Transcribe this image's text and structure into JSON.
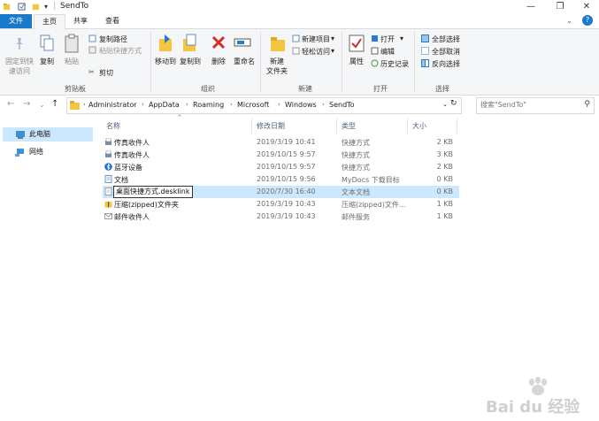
{
  "window": {
    "title": "SendTo",
    "controls": [
      "minimize-icon",
      "maximize-icon",
      "close-icon"
    ]
  },
  "tabs": [
    {
      "label": "文件"
    },
    {
      "label": "主页"
    },
    {
      "label": "共享"
    },
    {
      "label": "查看"
    }
  ],
  "ribbon": {
    "clipboard": {
      "pin_label_1": "固定到快",
      "pin_label_2": "速访问",
      "copy_label": "复制",
      "paste_label": "粘贴",
      "copy_path_label": "复制路径",
      "paste_shortcut_label": "粘贴快捷方式",
      "cut_label": "剪切",
      "group_label": "剪贴板"
    },
    "organize": {
      "move_to_label": "移动到",
      "copy_to_label": "复制到",
      "delete_label": "删除",
      "rename_label": "重命名",
      "group_label": "组织"
    },
    "new": {
      "new_folder_label_1": "新建",
      "new_folder_label_2": "文件夹",
      "new_item_label": "新建项目",
      "easy_access_label": "轻松访问",
      "group_label": "新建"
    },
    "open": {
      "properties_label": "属性",
      "open_label": "打开",
      "edit_label": "编辑",
      "history_label": "历史记录",
      "group_label": "打开"
    },
    "select": {
      "select_all_label": "全部选择",
      "select_none_label": "全部取消",
      "invert_label": "反向选择",
      "group_label": "选择"
    }
  },
  "address": {
    "breadcrumbs": [
      "Administrator",
      "AppData",
      "Roaming",
      "Microsoft",
      "Windows",
      "SendTo"
    ],
    "search_placeholder": "搜索\"SendTo\""
  },
  "nav_pane": {
    "items": [
      {
        "label": "此电脑",
        "selected": true,
        "icon": "computer-icon"
      },
      {
        "label": "网络",
        "selected": false,
        "icon": "network-icon"
      }
    ]
  },
  "file_list": {
    "columns": {
      "name": "名称",
      "date": "修改日期",
      "type": "类型",
      "size": "大小"
    },
    "rows": [
      {
        "name": "传真收件人",
        "date": "2019/3/19 10:41",
        "type": "快捷方式",
        "size": "2 KB",
        "icon": "fax-icon"
      },
      {
        "name": "传真收件人",
        "date": "2019/10/15 9:57",
        "type": "快捷方式",
        "size": "3 KB",
        "icon": "fax-icon"
      },
      {
        "name": "蓝牙设备",
        "date": "2019/10/15 9:57",
        "type": "快捷方式",
        "size": "2 KB",
        "icon": "bluetooth-icon"
      },
      {
        "name": "文档",
        "date": "2019/10/15 9:56",
        "type": "MyDocs 下载目标",
        "size": "0 KB",
        "icon": "documents-icon"
      },
      {
        "name": "桌面快捷方式.desklink",
        "date": "2020/7/30 16:40",
        "type": "文本文档",
        "size": "0 KB",
        "icon": "text-file-icon",
        "renaming": true
      },
      {
        "name": "压缩(zipped)文件夹",
        "date": "2019/3/19 10:43",
        "type": "压缩(zipped)文件...",
        "size": "1 KB",
        "icon": "zip-folder-icon"
      },
      {
        "name": "邮件收件人",
        "date": "2019/3/19 10:43",
        "type": "邮件服务",
        "size": "1 KB",
        "icon": "mail-icon"
      }
    ]
  },
  "watermark": {
    "text": "Bai du 经验"
  },
  "colors": {
    "accent": "#1979ca",
    "selection": "#cce8ff",
    "folder": "#f4c542"
  }
}
